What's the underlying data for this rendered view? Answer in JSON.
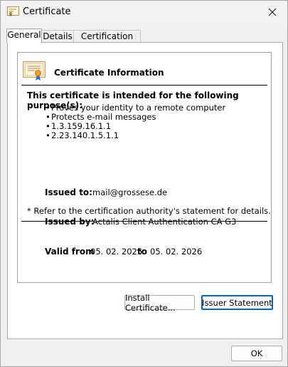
{
  "window": {
    "title": "Certificate"
  },
  "tabs": [
    {
      "label": "General",
      "active": true
    },
    {
      "label": "Details",
      "active": false
    },
    {
      "label": "Certification Path",
      "active": false
    }
  ],
  "info": {
    "title": "Certificate Information",
    "purpose_heading": "This certificate is intended for the following purpose(s):",
    "purposes": [
      "Proves your identity to a remote computer",
      "Protects e-mail messages",
      "1.3.159.16.1.1",
      "2.23.140.1.5.1.1"
    ],
    "refer_note": "* Refer to the certification authority's statement for details.",
    "issued_to_label": "Issued to:",
    "issued_to_value": "mail@grossese.de",
    "issued_by_label": "Issued by:",
    "issued_by_value": "Actalis Client Authentication CA G3",
    "valid_from_label": "Valid from",
    "valid_from_value": "05. 02. 2025",
    "valid_to_label": "to",
    "valid_to_value": "05. 02. 2026"
  },
  "buttons": {
    "install": "Install Certificate...",
    "issuer_statement": "Issuer Statement",
    "ok": "OK"
  },
  "icons": {
    "title": "certificate-icon",
    "close": "close-icon",
    "info": "certificate-ribbon-icon"
  }
}
